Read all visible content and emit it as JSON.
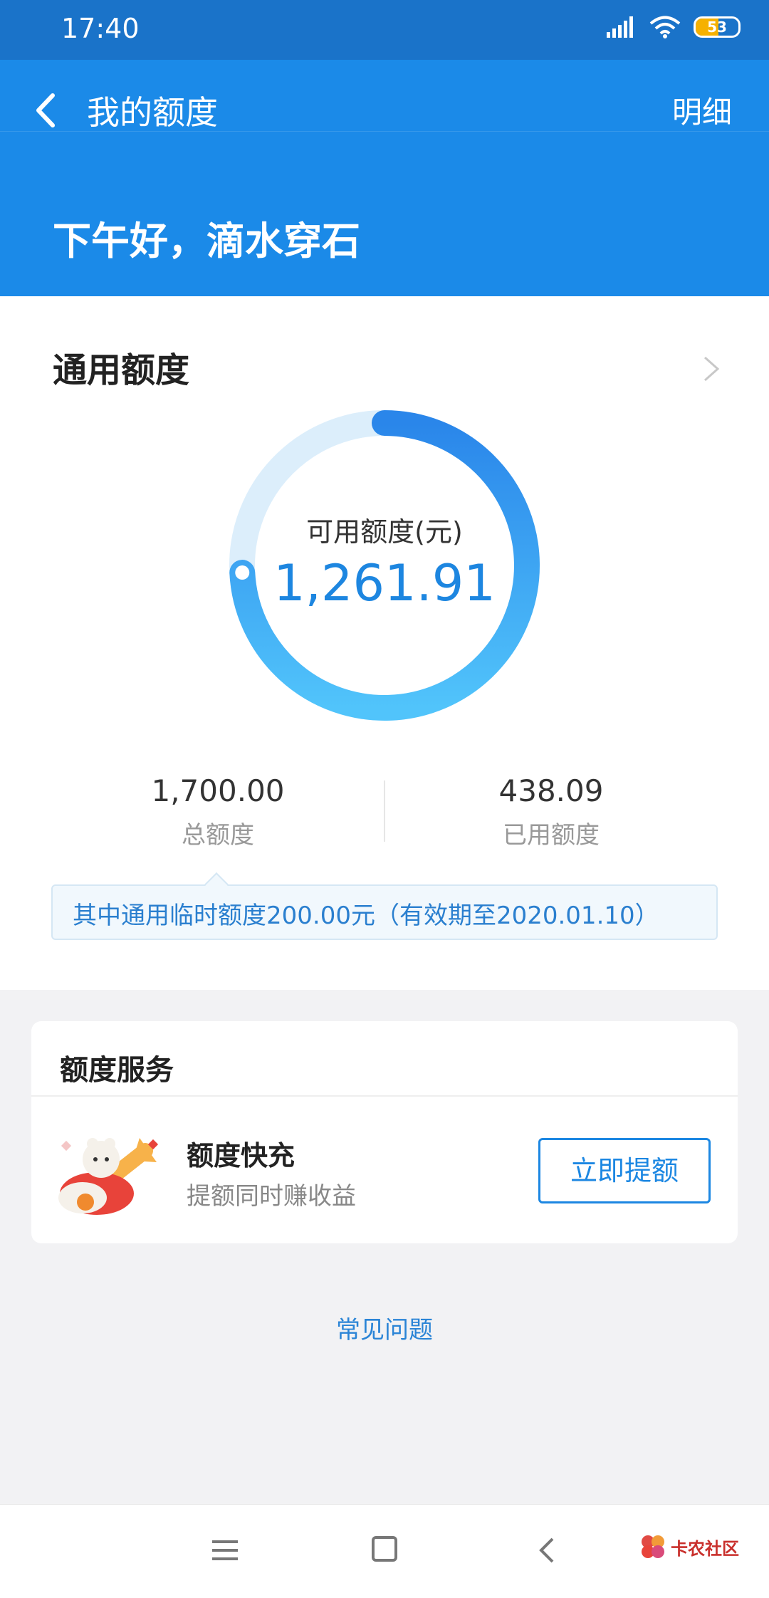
{
  "status_bar": {
    "time": "17:40",
    "battery": "53",
    "battery_level": 0.53
  },
  "nav": {
    "title": "我的额度",
    "detail": "明细"
  },
  "greeting": "下午好，滴水穿石",
  "credit": {
    "title": "通用额度",
    "available_label": "可用额度(元)",
    "available_value": "1,261.91",
    "available_fraction": 0.742,
    "total_value": "1,700.00",
    "total_label": "总额度",
    "used_value": "438.09",
    "used_label": "已用额度",
    "temp_note": "其中通用临时额度200.00元（有效期至2020.01.10）"
  },
  "service": {
    "section_title": "额度服务",
    "item_name": "额度快充",
    "item_desc": "提额同时赚收益",
    "button": "立即提额"
  },
  "faq": "常见问题",
  "watermark": {
    "text": "卡农社区"
  },
  "colors": {
    "header": "#1b8ae8",
    "status": "#1a73c9",
    "accent": "#1d86e0",
    "ring_track": "#dceefb"
  }
}
